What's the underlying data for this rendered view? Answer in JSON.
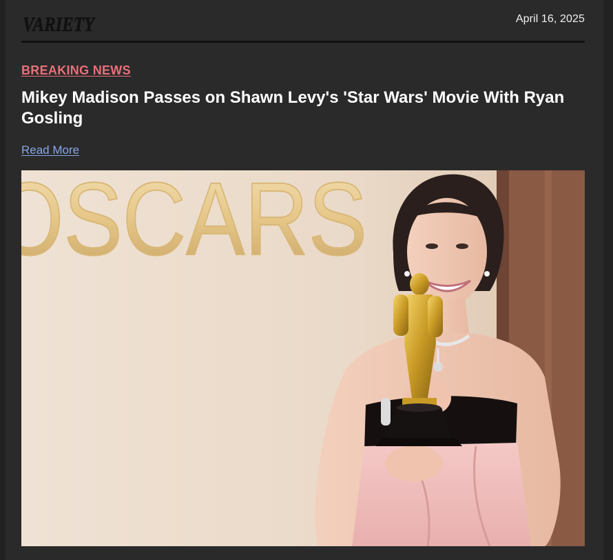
{
  "header": {
    "logo_text": "VARIETY",
    "date": "April 16, 2025"
  },
  "article": {
    "kicker": "BREAKING NEWS",
    "headline": "Mikey Madison Passes on Shawn Levy's 'Star Wars' Movie With Ryan Gosling",
    "read_more_label": "Read More"
  },
  "photo": {
    "backdrop_text": "OSCARS"
  },
  "colors": {
    "background": "#2a2a2a",
    "kicker": "#e8707a",
    "link": "#86a8e8",
    "headline": "#ffffff"
  }
}
